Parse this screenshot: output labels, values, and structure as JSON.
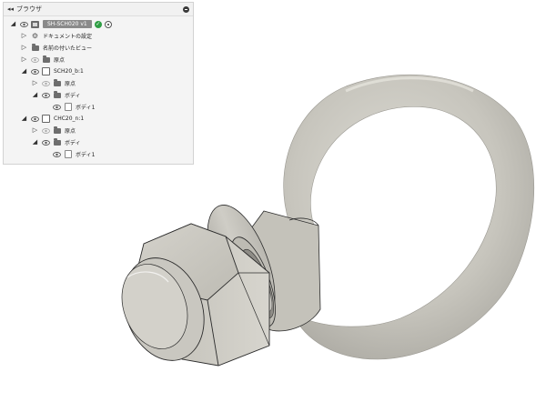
{
  "browser": {
    "collapse_icon": "double-left-arrow",
    "title": "ブラウザ",
    "minimize_icon": "minus-circle"
  },
  "tree": {
    "root": {
      "label": "SH-SCH020 v1",
      "expanded": true,
      "badge_icon": "version-badge",
      "record_icon": "activate-radio"
    },
    "document_settings": {
      "label": "ドキュメントの設定",
      "expanded": false
    },
    "named_views": {
      "label": "名前の付いたビュー",
      "expanded": false
    },
    "origin": {
      "label": "原点",
      "expanded": false
    },
    "component1": {
      "label": "SCH20_b:1",
      "expanded": true,
      "origin_label": "原点",
      "bodies_label": "ボディ",
      "body1_label": "ボディ1"
    },
    "component2": {
      "label": "CHC20_n:1",
      "expanded": true,
      "origin_label": "原点",
      "bodies_label": "ボディ",
      "body1_label": "ボディ1"
    }
  },
  "colors": {
    "panel_bg": "#f4f4f4",
    "model_gray": "#cac8c1",
    "model_edge": "#2c2c2c",
    "version_badge": "#2f9e44"
  }
}
